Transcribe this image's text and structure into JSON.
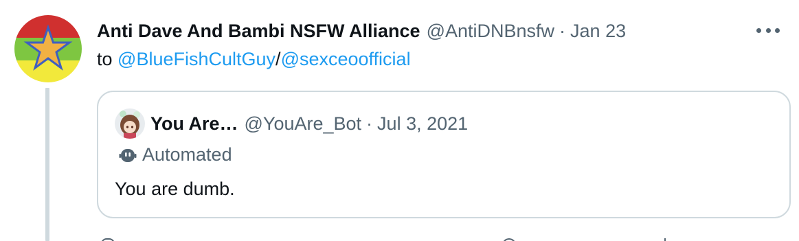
{
  "tweet": {
    "author": {
      "display_name": "Anti Dave And Bambi NSFW Alliance",
      "handle": "@AntiDNBnsfw",
      "avatar_icon": "star-flag-avatar"
    },
    "separator": "·",
    "date": "Jan 23",
    "reply_prefix": "to",
    "reply_to": [
      "@BlueFishCultGuy",
      "@sexceoofficial"
    ],
    "reply_separator": "/",
    "more_icon": "more-horizontal-icon"
  },
  "quote": {
    "author": {
      "display_name": "You Are…",
      "handle": "@YouAre_Bot",
      "avatar_icon": "anime-avatar"
    },
    "separator": "·",
    "date": "Jul 3, 2021",
    "label_icon": "robot-icon",
    "label": "Automated",
    "text": "You are dumb."
  },
  "colors": {
    "link": "#1d9bf0",
    "text_primary": "#0f1419",
    "text_secondary": "#536471",
    "border": "#cfd9de",
    "avatar_red": "#d0302f",
    "avatar_green": "#7ec641",
    "avatar_yellow": "#f2e93b",
    "star_fill": "#f1b143",
    "star_stroke": "#3f5fc0"
  }
}
